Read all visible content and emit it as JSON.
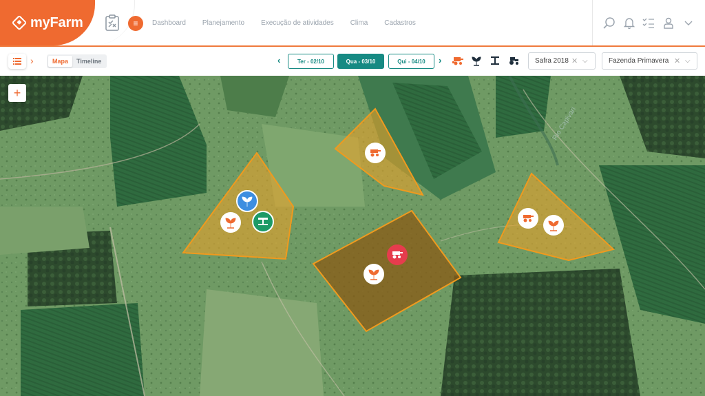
{
  "app": {
    "name": "myFarm"
  },
  "nav": {
    "items": [
      "Dashboard",
      "Planejamento",
      "Execução de atividades",
      "Clima",
      "Cadastros"
    ]
  },
  "topbar_icons": [
    "search-icon",
    "bell-icon",
    "checklist-icon",
    "user-icon",
    "chevron-down-icon"
  ],
  "view": {
    "map_label": "Mapa",
    "timeline_label": "Timeline",
    "active": "Mapa"
  },
  "dates": [
    {
      "label": "Ter - 02/10",
      "active": false
    },
    {
      "label": "Qua - 03/10",
      "active": true
    },
    {
      "label": "Qui - 04/10",
      "active": false
    }
  ],
  "tool_icons": [
    "harvester-icon",
    "planting-icon",
    "spraying-icon",
    "tractor-icon"
  ],
  "filters": {
    "season": "Safra 2018",
    "farm": "Fazenda Primavera"
  },
  "map": {
    "river_label": "Rio Capivari",
    "zoom_symbol": "+"
  },
  "colors": {
    "brand": "#ef6a30",
    "teal": "#168a83",
    "field_fill": "#e8a12a",
    "field_stroke": "#f09a1e",
    "marker_red": "#e63c4d",
    "marker_blue": "#3d8ee0",
    "marker_green": "#1c9a66"
  }
}
